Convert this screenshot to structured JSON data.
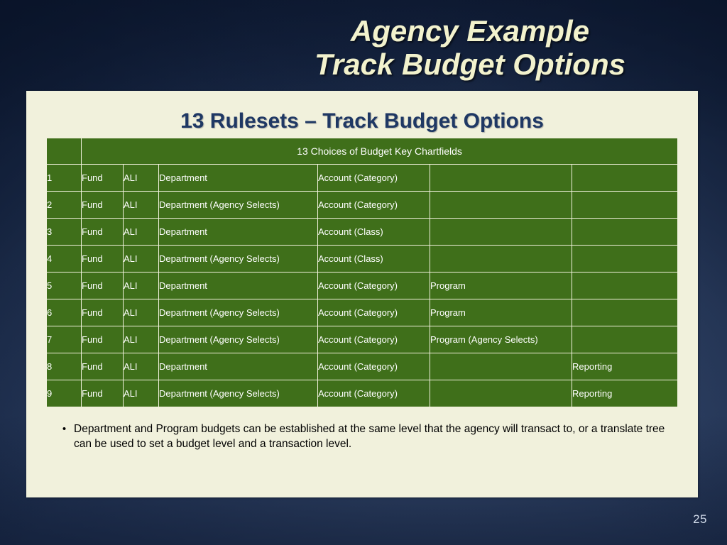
{
  "slide": {
    "background_color": "#1d2e4e",
    "panel_color": "#f1f1dc",
    "accent_green": "#3f6f1a",
    "heading_color": "#1f3864",
    "title_color": "#f2f2cd",
    "page_number": "25"
  },
  "title": {
    "line1": "Agency Example",
    "line2": "Track Budget Options"
  },
  "panel": {
    "heading": "13 Rulesets – Track Budget Options"
  },
  "table": {
    "header": "13 Choices of Budget Key Chartfields",
    "rows": [
      {
        "num": "1",
        "fund": "Fund",
        "ali": "ALI",
        "department": "Department",
        "account": "Account (Category)",
        "program": "",
        "reporting": ""
      },
      {
        "num": "2",
        "fund": "Fund",
        "ali": "ALI",
        "department": "Department (Agency Selects)",
        "account": "Account (Category)",
        "program": "",
        "reporting": ""
      },
      {
        "num": "3",
        "fund": "Fund",
        "ali": "ALI",
        "department": "Department",
        "account": "Account (Class)",
        "program": "",
        "reporting": ""
      },
      {
        "num": "4",
        "fund": "Fund",
        "ali": "ALI",
        "department": "Department (Agency Selects)",
        "account": "Account (Class)",
        "program": "",
        "reporting": ""
      },
      {
        "num": "5",
        "fund": "Fund",
        "ali": "ALI",
        "department": "Department",
        "account": "Account (Category)",
        "program": "Program",
        "reporting": ""
      },
      {
        "num": "6",
        "fund": "Fund",
        "ali": "ALI",
        "department": "Department (Agency Selects)",
        "account": "Account (Category)",
        "program": "Program",
        "reporting": ""
      },
      {
        "num": "7",
        "fund": "Fund",
        "ali": "ALI",
        "department": "Department (Agency Selects)",
        "account": "Account (Category)",
        "program": "Program  (Agency Selects)",
        "reporting": ""
      },
      {
        "num": "8",
        "fund": "Fund",
        "ali": "ALI",
        "department": "Department",
        "account": "Account (Category)",
        "program": "",
        "reporting": "Reporting"
      },
      {
        "num": "9",
        "fund": "Fund",
        "ali": "ALI",
        "department": "Department (Agency Selects)",
        "account": "Account (Category)",
        "program": "",
        "reporting": "Reporting"
      }
    ]
  },
  "bullets": [
    {
      "marker": "•",
      "text": "Department and Program budgets can be established at the same level that the agency will transact to, or a translate tree can be used to set a budget level and a transaction level."
    }
  ]
}
